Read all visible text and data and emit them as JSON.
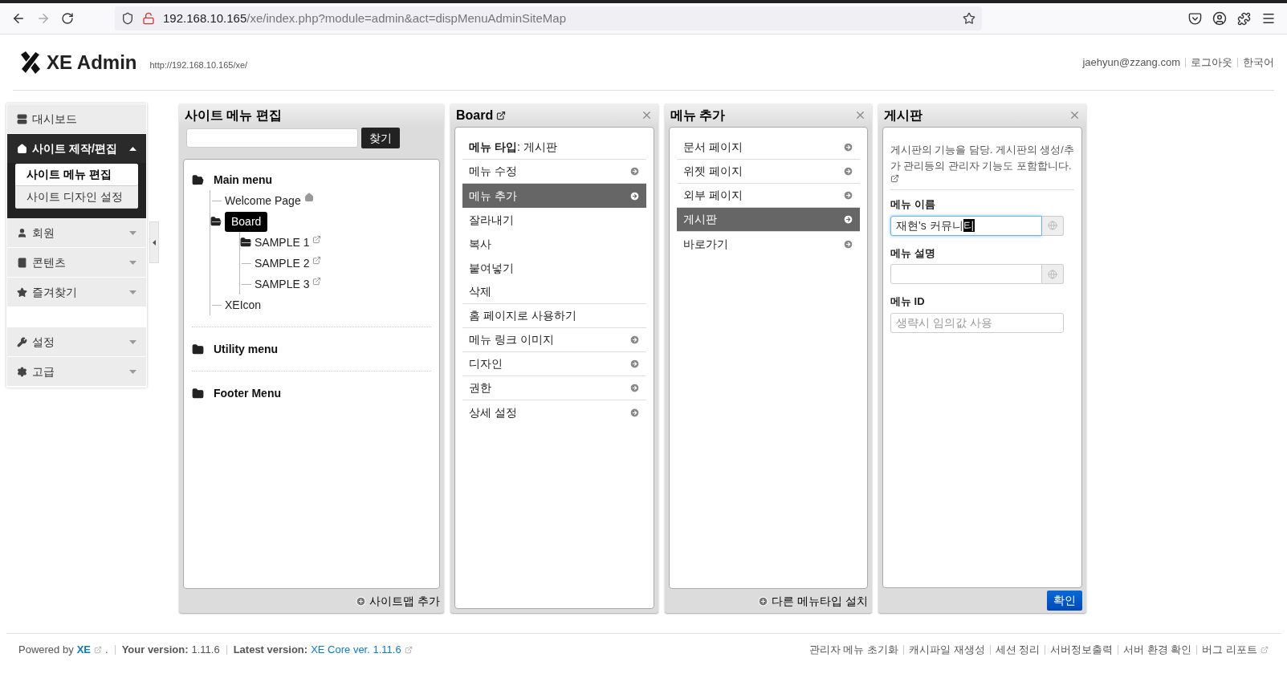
{
  "browser": {
    "url_host": "192.168.10.165",
    "url_path": "/xe/index.php?module=admin&act=dispMenuAdminSiteMap"
  },
  "header": {
    "logo_text": "XE Admin",
    "site_url": "http://192.168.10.165/xe/",
    "user_email": "jaehyun@zzang.com",
    "logout": "로그아웃",
    "language": "한국어"
  },
  "sidebar": {
    "sections": [
      [
        {
          "label": "대시보드",
          "expandable": false,
          "expanded": false
        },
        {
          "label": "사이트 제작/편집",
          "expandable": true,
          "expanded": true,
          "children": [
            {
              "label": "사이트 메뉴 편집",
              "selected": true
            },
            {
              "label": "사이트 디자인 설정",
              "selected": false
            }
          ]
        },
        {
          "label": "회원",
          "expandable": true,
          "expanded": false
        },
        {
          "label": "콘텐츠",
          "expandable": true,
          "expanded": false
        },
        {
          "label": "즐겨찾기",
          "expandable": true,
          "expanded": false
        }
      ],
      [
        {
          "label": "설정",
          "expandable": true,
          "expanded": false
        },
        {
          "label": "고급",
          "expandable": true,
          "expanded": false
        }
      ]
    ]
  },
  "sitemap_panel": {
    "title": "사이트 메뉴 편집",
    "search_button": "찾기",
    "tree": [
      {
        "label": "Main menu",
        "expanded": true,
        "children": [
          {
            "label": "Welcome Page",
            "kind": "page",
            "home": true,
            "external": false,
            "selected": false
          },
          {
            "label": "Board",
            "kind": "folder",
            "expanded": true,
            "home": false,
            "external": false,
            "selected": true,
            "children": [
              {
                "label": "SAMPLE 1",
                "kind": "folder",
                "expanded": false,
                "home": false,
                "external": true,
                "selected": false
              },
              {
                "label": "SAMPLE 2",
                "kind": "page",
                "home": false,
                "external": true,
                "selected": false
              },
              {
                "label": "SAMPLE 3",
                "kind": "page",
                "home": false,
                "external": true,
                "selected": false
              }
            ]
          },
          {
            "label": "XEIcon",
            "kind": "page",
            "home": false,
            "external": false,
            "selected": false
          }
        ]
      },
      {
        "label": "Utility menu",
        "expanded": false
      },
      {
        "label": "Footer Menu",
        "expanded": false
      }
    ],
    "footer_action": "사이트맵 추가"
  },
  "board_panel": {
    "title": "Board",
    "rows": [
      {
        "label": "**메뉴 타입**: 게시판",
        "arrow": false,
        "selected": false,
        "divider": true
      },
      {
        "label": "메뉴 수정",
        "arrow": true,
        "selected": false,
        "divider": true
      },
      {
        "label": "메뉴 추가",
        "arrow": true,
        "selected": true,
        "divider": false
      },
      {
        "label": "잘라내기",
        "arrow": false,
        "selected": false,
        "divider": false
      },
      {
        "label": "복사",
        "arrow": false,
        "selected": false,
        "divider": false
      },
      {
        "label": "붙여넣기",
        "arrow": false,
        "selected": false,
        "divider": false
      },
      {
        "label": "삭제",
        "arrow": false,
        "selected": false,
        "divider": true
      },
      {
        "label": "홈 페이지로 사용하기",
        "arrow": false,
        "selected": false,
        "divider": true
      },
      {
        "label": "메뉴 링크 이미지",
        "arrow": true,
        "selected": false,
        "divider": true
      },
      {
        "label": "디자인",
        "arrow": true,
        "selected": false,
        "divider": true
      },
      {
        "label": "권한",
        "arrow": true,
        "selected": false,
        "divider": true
      },
      {
        "label": "상세 설정",
        "arrow": true,
        "selected": false,
        "divider": false
      }
    ]
  },
  "add_panel": {
    "title": "메뉴 추가",
    "rows": [
      {
        "label": "문서 페이지",
        "selected": false
      },
      {
        "label": "위젯 페이지",
        "selected": false
      },
      {
        "label": "외부 페이지",
        "selected": false
      },
      {
        "label": "게시판",
        "selected": true
      },
      {
        "label": "바로가기",
        "selected": false
      }
    ],
    "footer_action": "다른 메뉴타입 설치"
  },
  "form_panel": {
    "title": "게시판",
    "description": "게시판의 기능을 담당. 게시판의 생성/추가 관리등의 관리자 기능도 포함합니다.",
    "fields": [
      {
        "label": "메뉴 이름",
        "kind": "multilang",
        "value": "재현's 커뮤니티",
        "composing": true,
        "focused": true
      },
      {
        "label": "메뉴 설명",
        "kind": "multilang",
        "focused": false
      },
      {
        "label": "메뉴 ID",
        "kind": "plain",
        "placeholder": "생략시 임의값 사용",
        "focused": false
      }
    ],
    "submit": "확인"
  },
  "footer": {
    "powered_label": "Powered by",
    "powered_link": "XE",
    "powered_suffix": ".",
    "your_version_label": "Your version:",
    "your_version": "1.11.6",
    "latest_label": "Latest version:",
    "latest_link": "XE Core ver. 1.11.6",
    "links": [
      "관리자 메뉴 초기화",
      "캐시파일 재생성",
      "세션 정리",
      "서버정보출력",
      "서버 환경 확인",
      "버그 리포트"
    ]
  }
}
